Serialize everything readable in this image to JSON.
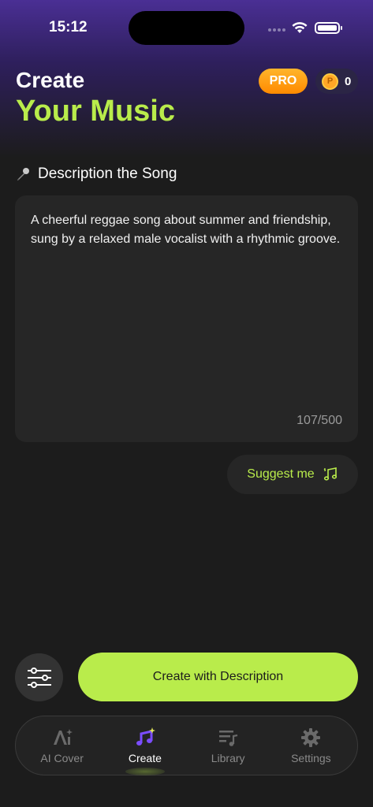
{
  "status": {
    "time": "15:12"
  },
  "header": {
    "title_line1": "Create",
    "title_line2": "Your Music",
    "pro_label": "PRO",
    "coin_symbol": "P",
    "coin_count": "0"
  },
  "section": {
    "label": "Description the Song",
    "icon": "microphone-icon"
  },
  "description": {
    "value": "A cheerful reggae song about summer and friendship, sung by a relaxed male vocalist with a rhythmic groove.",
    "counter": "107/500"
  },
  "suggest": {
    "label": "Suggest me",
    "icon": "music-notes-icon"
  },
  "actions": {
    "create_label": "Create with Description",
    "settings_icon": "sliders-icon"
  },
  "tabs": [
    {
      "label": "AI Cover",
      "icon": "ai-sparkle-icon",
      "active": false
    },
    {
      "label": "Create",
      "icon": "music-note-sparkle-icon",
      "active": true
    },
    {
      "label": "Library",
      "icon": "playlist-icon",
      "active": false
    },
    {
      "label": "Settings",
      "icon": "gear-icon",
      "active": false
    }
  ],
  "colors": {
    "accent": "#b9ec4b",
    "pro": "#ff9a10",
    "purple": "#4a2f94",
    "background": "#1c1c1c"
  }
}
